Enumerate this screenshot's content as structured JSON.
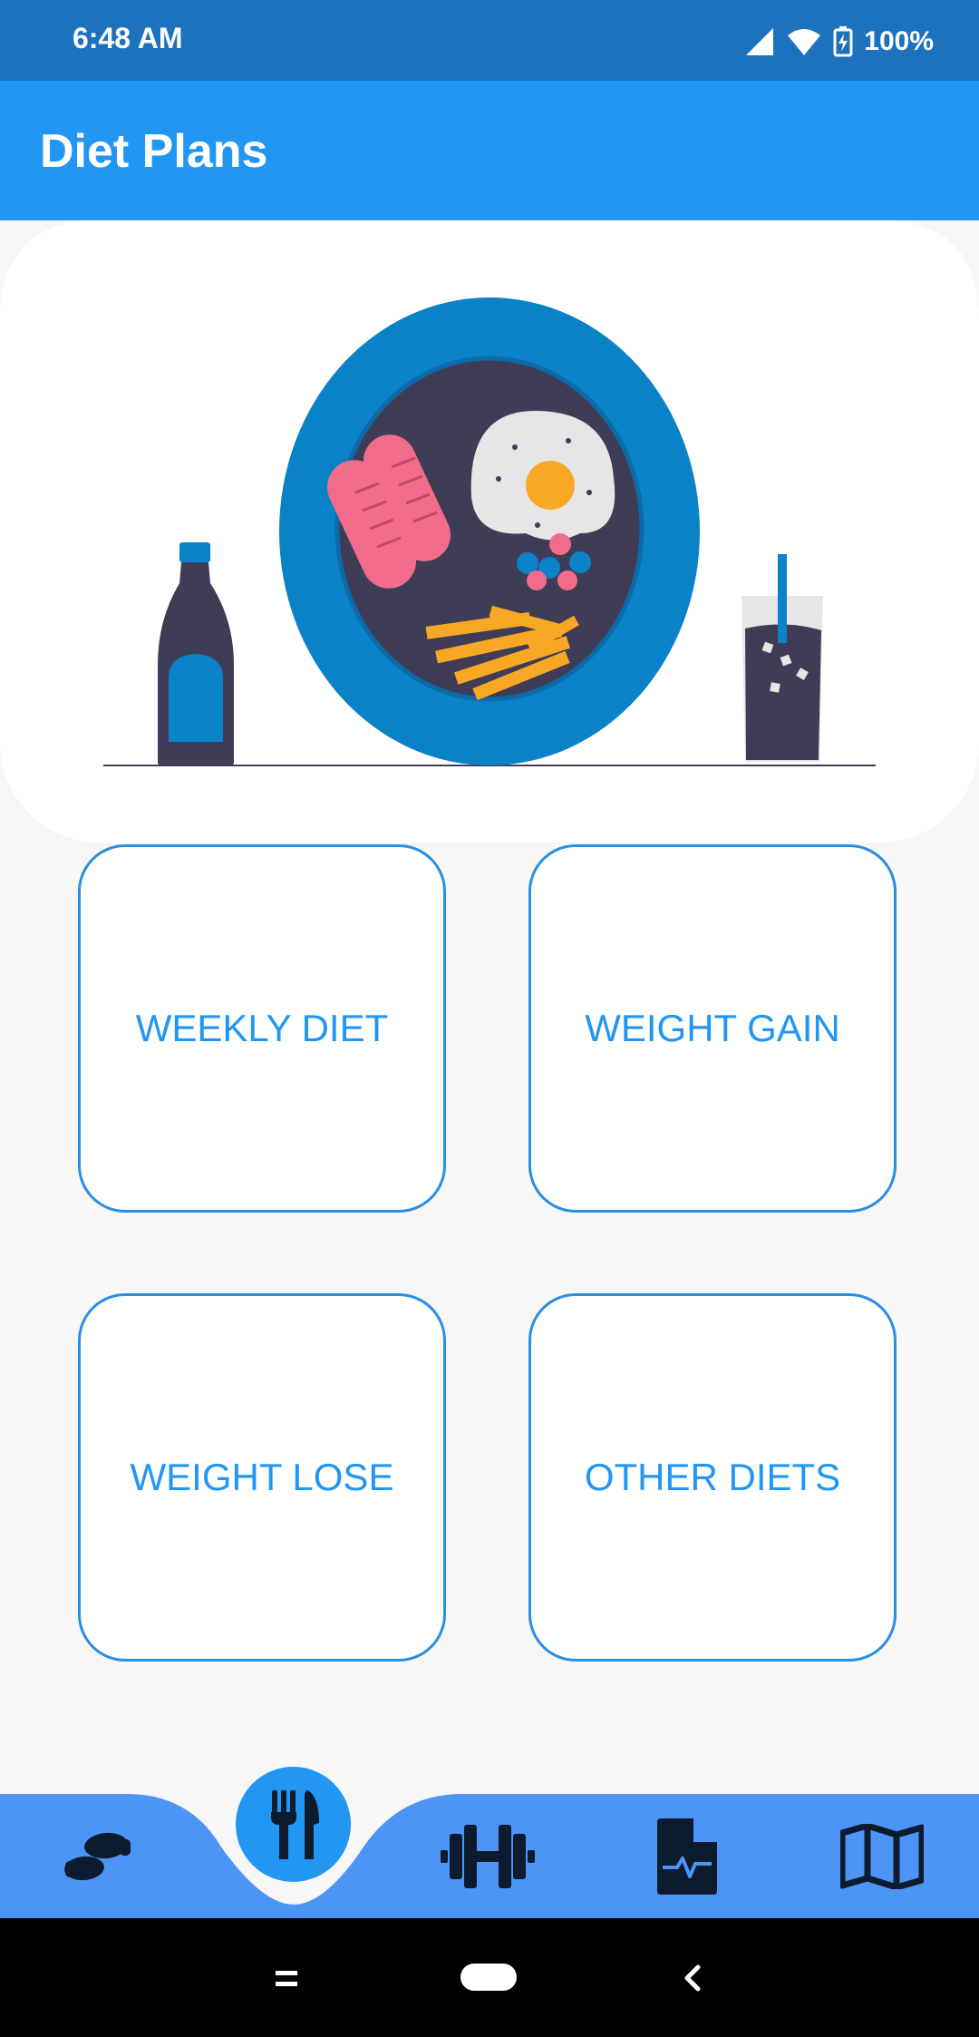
{
  "status": {
    "time": "6:48 AM",
    "battery": "100%"
  },
  "app_bar": {
    "title": "Diet Plans"
  },
  "tiles": [
    {
      "label": "WEEKLY DIET"
    },
    {
      "label": "WEIGHT GAIN"
    },
    {
      "label": "WEIGHT LOSE"
    },
    {
      "label": "OTHER DIETS"
    }
  ],
  "bottom_nav": {
    "items": [
      {
        "icon": "footprints-icon"
      },
      {
        "icon": "utensils-icon",
        "active": true
      },
      {
        "icon": "dumbbell-icon"
      },
      {
        "icon": "health-file-icon"
      },
      {
        "icon": "map-icon"
      }
    ]
  },
  "colors": {
    "status_bar": "#1c72bd",
    "app_bar": "#2196f3",
    "accent": "#2196f3",
    "icon_dark": "#0d1b2e"
  }
}
